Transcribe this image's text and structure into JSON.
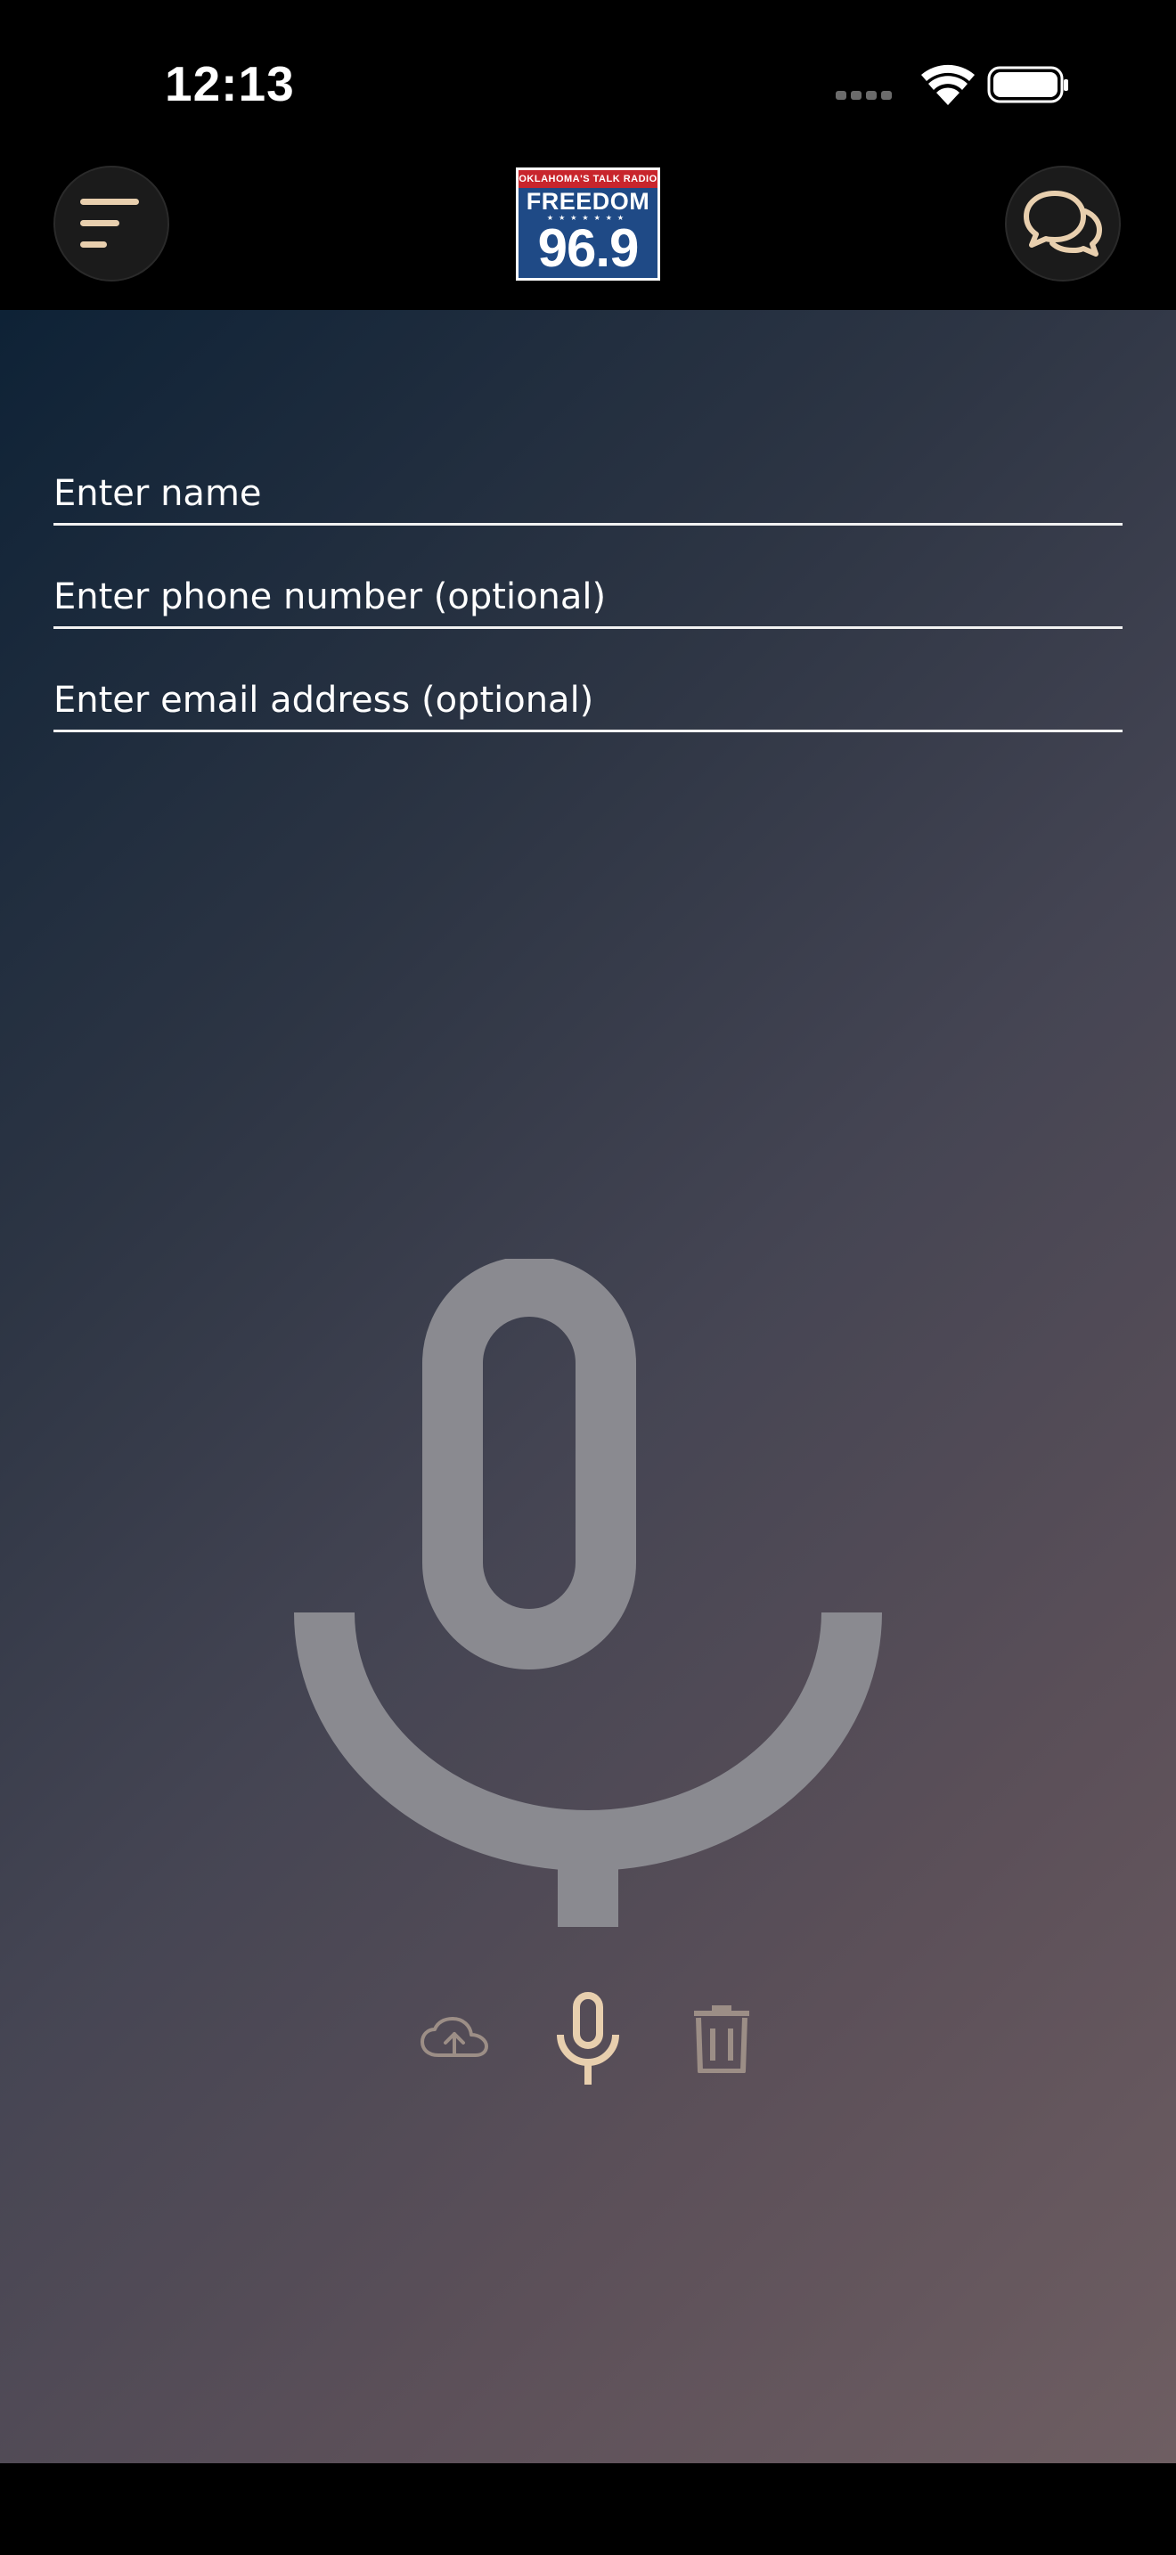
{
  "status_bar": {
    "time": "12:13",
    "icons": [
      "signal-dots-icon",
      "wifi-icon",
      "battery-icon"
    ]
  },
  "header": {
    "menu_icon": "menu-icon",
    "chat_icon": "chat-bubbles-icon",
    "logo": {
      "tagline": "OKLAHOMA'S TALK RADIO",
      "name": "FREEDOM",
      "frequency": "96.9"
    }
  },
  "form": {
    "name_placeholder": "Enter name",
    "phone_placeholder": "Enter phone number (optional)",
    "email_placeholder": "Enter email address (optional)"
  },
  "recorder": {
    "main_icon": "microphone-icon",
    "controls": [
      {
        "name": "upload",
        "icon": "cloud-upload-icon"
      },
      {
        "name": "record",
        "icon": "microphone-icon"
      },
      {
        "name": "delete",
        "icon": "trash-icon"
      }
    ]
  },
  "colors": {
    "accent": "#e8cfae",
    "muted_control": "#9c8e86",
    "mic_gray": "#8a8a90"
  }
}
